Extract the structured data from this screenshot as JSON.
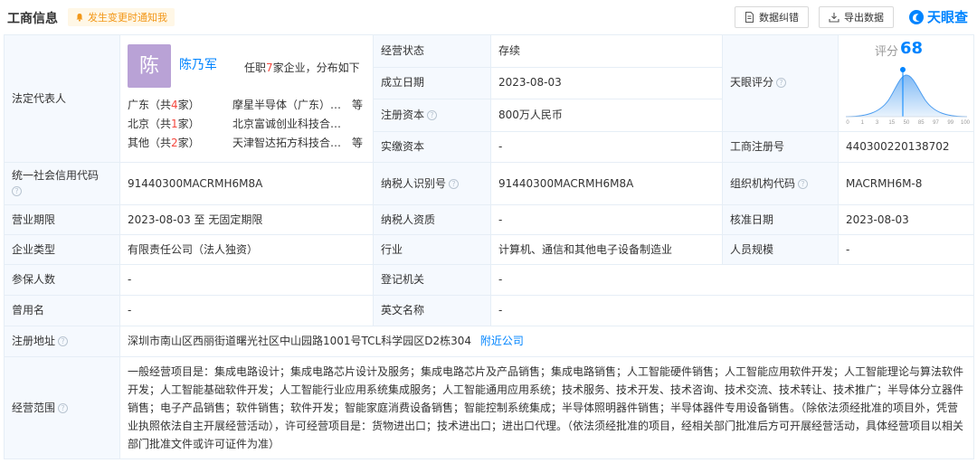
{
  "header": {
    "title": "工商信息",
    "notify_label": "发生变更时通知我",
    "report_error": "数据纠错",
    "export": "导出数据",
    "logo": "天眼查"
  },
  "legal_rep": {
    "label": "法定代表人",
    "avatar_char": "陈",
    "name": "陈乃军",
    "tenure_prefix": "任职",
    "tenure_count": "7",
    "tenure_suffix": "家企业，分布如下",
    "regions": [
      {
        "prefix": "广东（共",
        "count": "4",
        "suffix": "家）",
        "company": "摩星半导体（广东）…",
        "more": "等"
      },
      {
        "prefix": "北京（共",
        "count": "1",
        "suffix": "家）",
        "company": "北京富诚创业科技合…",
        "more": ""
      },
      {
        "prefix": "其他（共",
        "count": "2",
        "suffix": "家）",
        "company": "天津智达拓方科技合…",
        "more": "等"
      }
    ]
  },
  "fields": {
    "status_label": "经营状态",
    "status": "存续",
    "founded_label": "成立日期",
    "founded": "2023-08-03",
    "reg_capital_label": "注册资本",
    "reg_capital": "800万人民币",
    "paid_capital_label": "实缴资本",
    "paid_capital": "-",
    "tianyan_label": "天眼评分",
    "reg_no_label": "工商注册号",
    "reg_no": "440300220138702",
    "credit_code_label": "统一社会信用代码",
    "credit_code": "91440300MACRMH6M8A",
    "taxpayer_id_label": "纳税人识别号",
    "taxpayer_id": "91440300MACRMH6M8A",
    "org_code_label": "组织机构代码",
    "org_code": "MACRMH6M-8",
    "term_label": "营业期限",
    "term": "2023-08-03 至 无固定期限",
    "taxpayer_qual_label": "纳税人资质",
    "taxpayer_qual": "-",
    "approval_label": "核准日期",
    "approval": "2023-08-03",
    "type_label": "企业类型",
    "type": "有限责任公司（法人独资）",
    "industry_label": "行业",
    "industry": "计算机、通信和其他电子设备制造业",
    "staff_label": "人员规模",
    "staff": "-",
    "insured_label": "参保人数",
    "insured": "-",
    "authority_label": "登记机关",
    "authority": "-",
    "former_label": "曾用名",
    "former": "-",
    "english_label": "英文名称",
    "english": "-",
    "address_label": "注册地址",
    "address": "深圳市南山区西丽街道曙光社区中山园路1001号TCL科学园区D2栋304",
    "nearby": "附近公司",
    "scope_label": "经营范围",
    "scope": "一般经营项目是：集成电路设计；集成电路芯片设计及服务；集成电路芯片及产品销售；集成电路销售；人工智能硬件销售；人工智能应用软件开发；人工智能理论与算法软件开发；人工智能基础软件开发；人工智能行业应用系统集成服务；人工智能通用应用系统；技术服务、技术开发、技术咨询、技术交流、技术转让、技术推广；半导体分立器件销售；电子产品销售；软件销售；软件开发；智能家庭消费设备销售；智能控制系统集成；半导体照明器件销售；半导体器件专用设备销售。（除依法须经批准的项目外，凭营业执照依法自主开展经营活动），许可经营项目是：货物进出口；技术进出口；进出口代理。（依法须经批准的项目，经相关部门批准后方可开展经营活动，具体经营项目以相关部门批准文件或许可证件为准）"
  },
  "score": {
    "label": "评分",
    "value": "68",
    "axis_ticks": [
      "0",
      "1",
      "3",
      "15",
      "50",
      "85",
      "97",
      "99",
      "100"
    ],
    "colors": {
      "accent": "#0084ff",
      "curve_fill": "#cfe4fb"
    }
  },
  "colors": {
    "label_bg": "#f5f9fe",
    "border": "#e6eef6",
    "link": "#0084ff",
    "highlight": "#f4483e",
    "notify_text": "#f29718"
  }
}
